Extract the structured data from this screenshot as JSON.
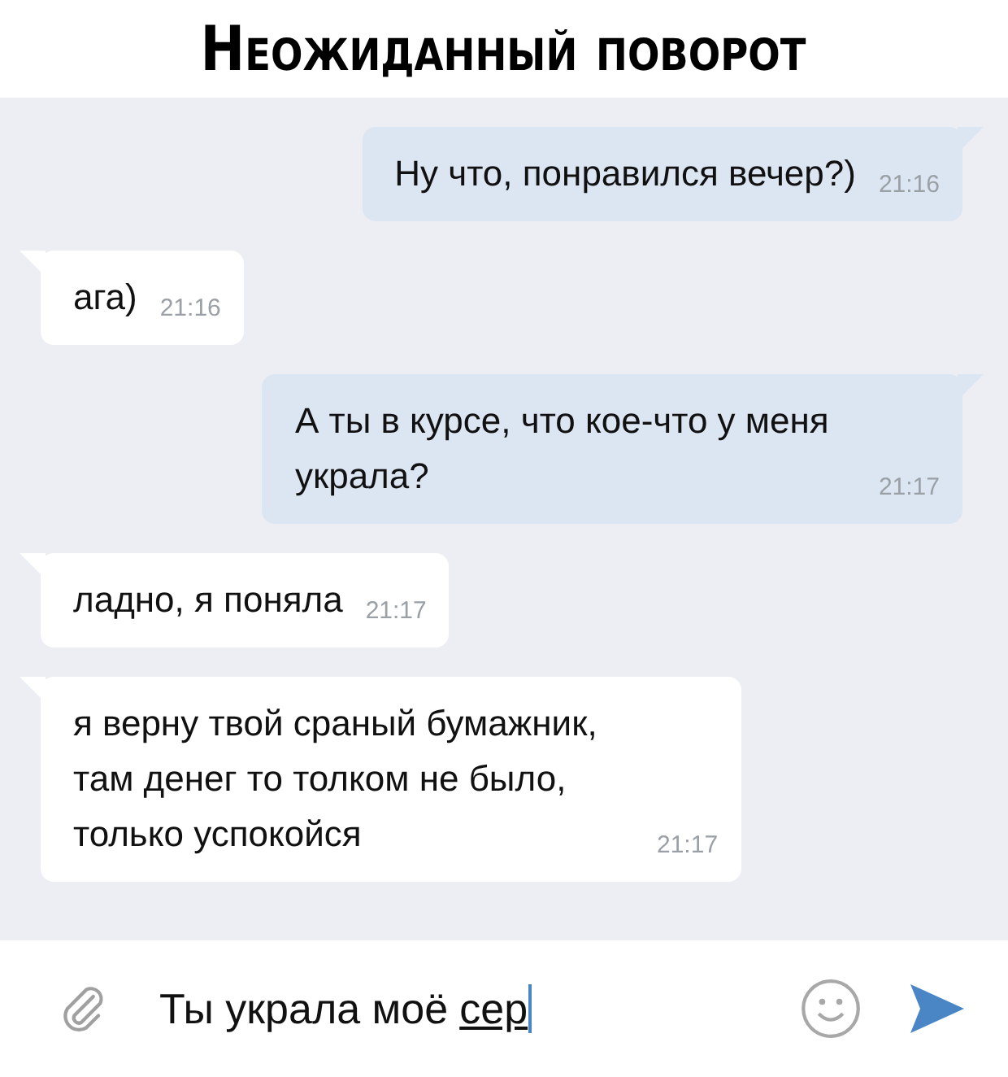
{
  "caption": "Неожиданный поворот",
  "messages": [
    {
      "kind": "outgoing",
      "text": "Ну что, понравился вечер?)",
      "time": "21:16"
    },
    {
      "kind": "incoming",
      "text": "ага)",
      "time": "21:16"
    },
    {
      "kind": "outgoing",
      "text": "А ты в курсе, что кое-что у меня украла?",
      "time": "21:17"
    },
    {
      "kind": "incoming",
      "text": "ладно, я поняла",
      "time": "21:17"
    },
    {
      "kind": "incoming",
      "text": "я верну твой сраный бумажник, там денег то толком не было, только успокойся",
      "time": "21:17"
    }
  ],
  "composer": {
    "value": "Ты украла моё",
    "composing": "сер"
  }
}
